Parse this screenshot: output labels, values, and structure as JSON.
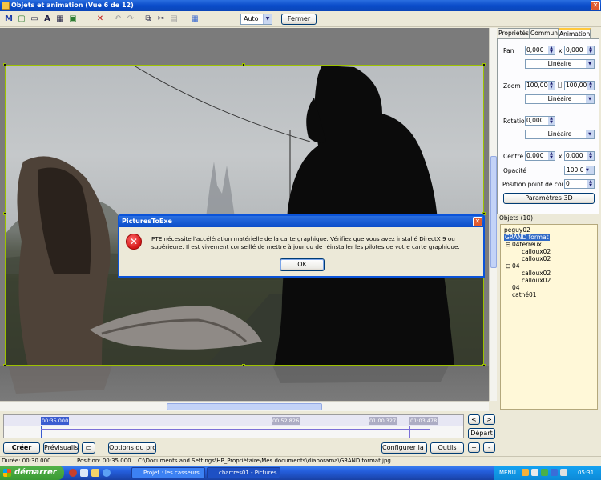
{
  "window": {
    "title": "Objets et animation  (Vue 6 de 12)",
    "close_glyph": "✕"
  },
  "toolbar": {
    "icons": [
      "M",
      "▢",
      "▭",
      "A",
      "▦",
      "▣",
      "✕",
      "↶",
      "↷",
      "⧉",
      "✂",
      "▤",
      "▦"
    ],
    "zoom_value": "Auto",
    "close_label": "Fermer"
  },
  "right_panel": {
    "tabs": [
      "Propriétés",
      "Commun",
      "Animation"
    ],
    "pan_label": "Pan",
    "pan_x": "0,000",
    "pan_y": "0,000",
    "times": "x",
    "pan_mode": "Linéaire",
    "zoom_label": "Zoom",
    "zoom_x": "100,000",
    "zoom_y": "100,000",
    "zoom_mode": "Linéaire",
    "rotation_label": "Rotation",
    "rotation_value": "0,000",
    "rotation_mode": "Linéaire",
    "center_label": "Centre",
    "center_x": "0,000",
    "center_y": "0,000",
    "opacity_label": "Opacité",
    "opacity_value": "100,0",
    "control_label": "Position point de contrô",
    "control_value": "0",
    "params3d_label": "Paramètres 3D"
  },
  "objects": {
    "header": "Objets (10)",
    "items": [
      {
        "label": "peguy02"
      },
      {
        "label": "GRAND format"
      },
      {
        "label": "04terreux"
      },
      {
        "label": "calloux02"
      },
      {
        "label": "calloux02"
      },
      {
        "label": "04"
      },
      {
        "label": "calloux02"
      },
      {
        "label": "calloux02"
      },
      {
        "label": "04"
      },
      {
        "label": "cathé01"
      }
    ]
  },
  "timeline": {
    "markers": [
      "00:35.000",
      "00:52.826",
      "01:00.327",
      "01:03.478"
    ],
    "prev_label": "<",
    "next_label": ">",
    "start_label": "Départ",
    "plus_label": "+",
    "minus_label": "-"
  },
  "bottom_buttons": {
    "create": "Créer",
    "preview": "Prévisualiser",
    "project_options": "Options du projet",
    "configure_view": "Configurer la vue",
    "tools": "Outils"
  },
  "status": {
    "duration": "Durée:   00:30.000",
    "position": "Position:   00:35.000",
    "path": "C:\\Documents and Settings\\HP_Propriétaire\\Mes documents\\diaporama\\GRAND format.jpg"
  },
  "dialog": {
    "title": "PicturesToExe",
    "message": "PTE nécessite l'accélération matérielle de la carte graphique. Vérifiez que vous avez installé DirectX 9 ou supérieure. Il est vivement conseillé de mettre à jour ou de réinstaller les pilotes de votre carte graphique.",
    "ok_label": "OK",
    "close_glyph": "✕"
  },
  "taskbar": {
    "start_label": "démarrer",
    "tasks": [
      "Projet : les casseurs ...",
      "chartres01 - Pictures..."
    ],
    "menu_label": "MENU",
    "clock": "05:31"
  }
}
